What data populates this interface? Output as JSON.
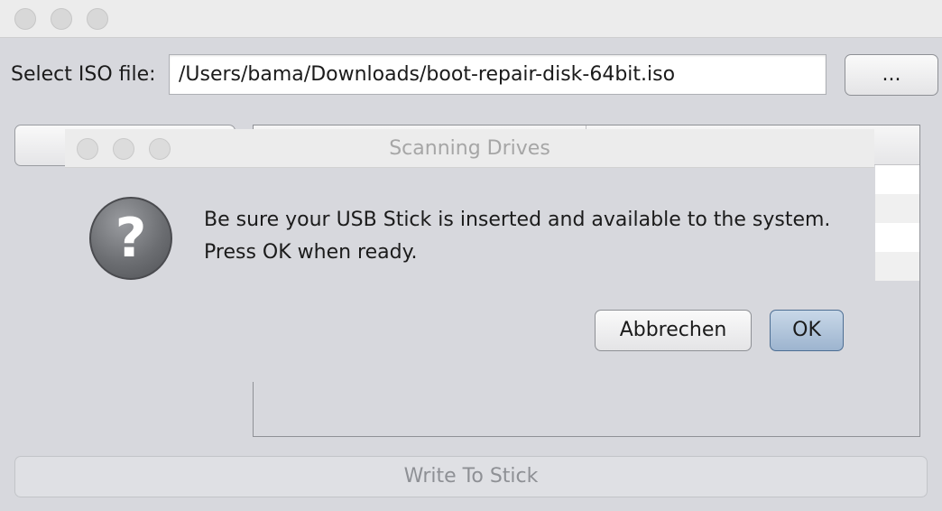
{
  "main_window": {
    "iso": {
      "label": "Select ISO file:",
      "path": "/Users/bama/Downloads/boot-repair-disk-64bit.iso",
      "browse_label": "..."
    },
    "write_button_label": "Write To Stick"
  },
  "dialog": {
    "title": "Scanning Drives",
    "icon": "question-icon",
    "icon_glyph": "?",
    "message_line1": "Be sure your USB Stick is inserted and available to the system.",
    "message_line2": "Press OK when ready.",
    "cancel_label": "Abbrechen",
    "ok_label": "OK"
  },
  "colors": {
    "window_bg": "#d7d8dd",
    "default_button": "#9db4cf"
  }
}
